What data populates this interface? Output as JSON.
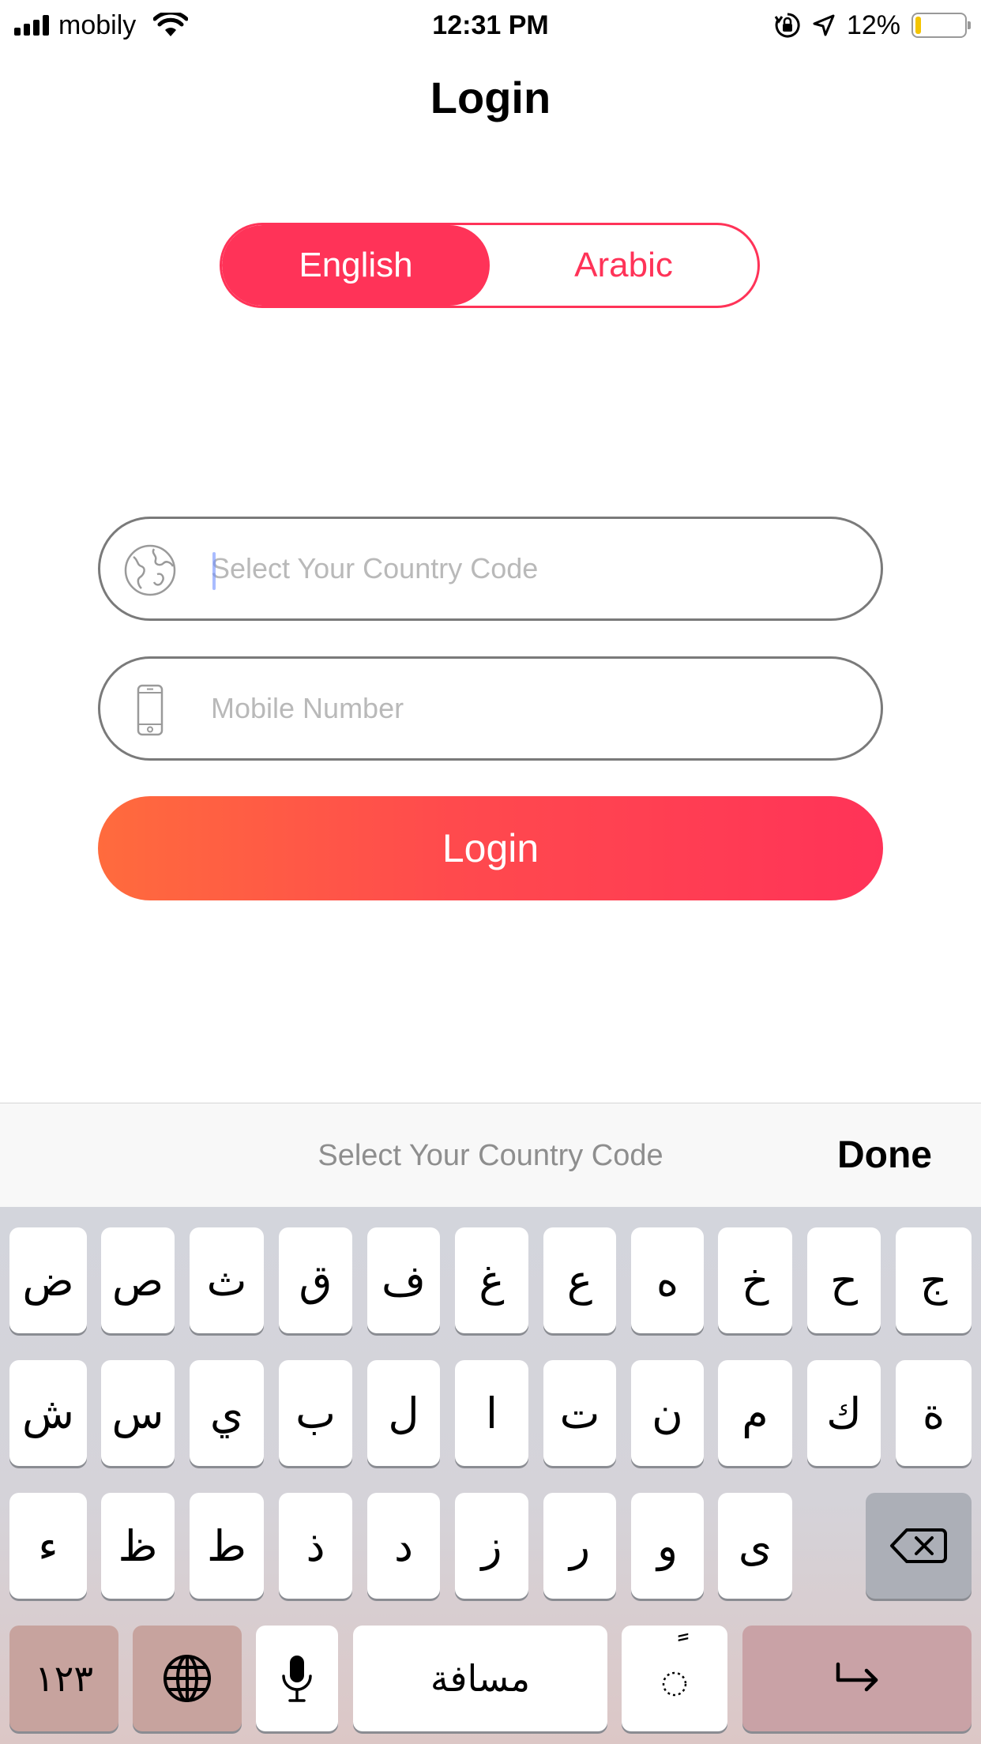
{
  "status": {
    "carrier": "mobily",
    "time": "12:31 PM",
    "battery_pct": "12%",
    "battery_level": 0.12,
    "battery_color": "#f4c400"
  },
  "page": {
    "title": "Login"
  },
  "lang": {
    "english": "English",
    "arabic": "Arabic",
    "selected": "English",
    "accent": "#ff3358"
  },
  "form": {
    "country_placeholder": "Select Your Country Code",
    "country_value": "",
    "mobile_placeholder": "Mobile Number",
    "mobile_value": "",
    "login_label": "Login"
  },
  "accessory": {
    "title": "Select Your Country Code",
    "done": "Done"
  },
  "keyboard": {
    "row1": [
      "ض",
      "ص",
      "ث",
      "ق",
      "ف",
      "غ",
      "ع",
      "ه",
      "خ",
      "ح",
      "ج"
    ],
    "row2": [
      "ش",
      "س",
      "ي",
      "ب",
      "ل",
      "ا",
      "ت",
      "ن",
      "م",
      "ك",
      "ة"
    ],
    "row3": [
      "ء",
      "ظ",
      "ط",
      "ذ",
      "د",
      "ز",
      "ر",
      "و",
      "ى"
    ],
    "numbers": "١٢٣",
    "space": "مسافة",
    "diacritic": "ً"
  }
}
